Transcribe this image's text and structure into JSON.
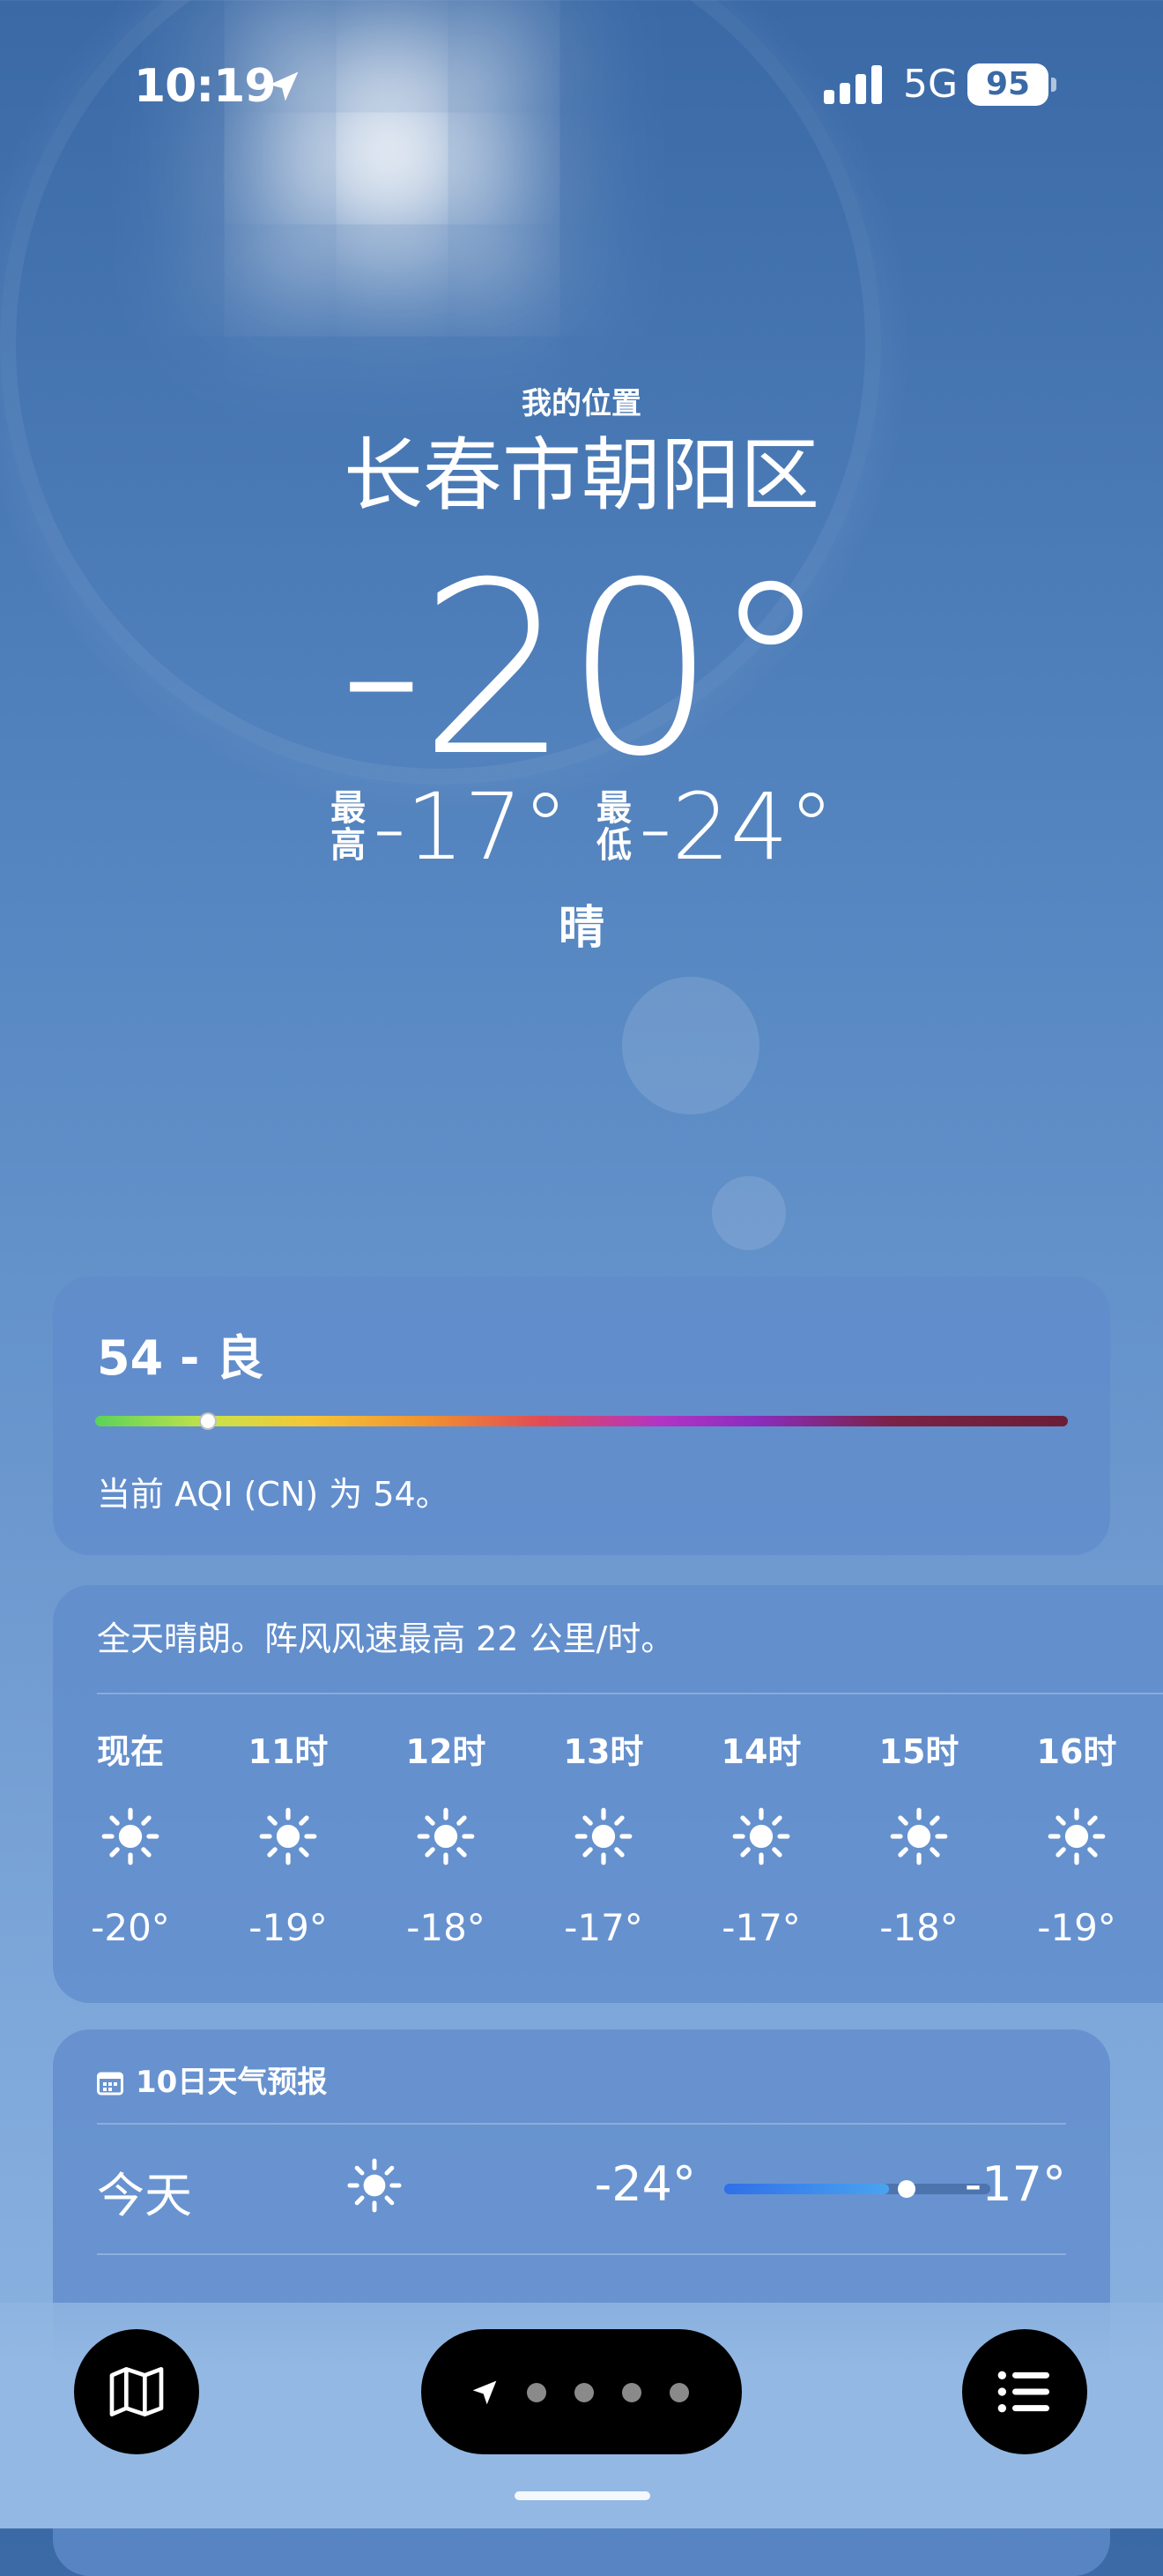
{
  "status_bar": {
    "time": "10:19",
    "network": "5G",
    "battery": "95"
  },
  "header": {
    "my_location": "我的位置",
    "city": "长春市朝阳区",
    "temperature": "-20°",
    "high_label": "最高",
    "high": "-17°",
    "low_label": "最低",
    "low": "-24°",
    "condition": "晴"
  },
  "aqi": {
    "title": "54 - 良",
    "value": 54,
    "description": "当前 AQI (CN) 为 54。"
  },
  "hourly": {
    "summary": "全天晴朗。阵风风速最高 22 公里/时。",
    "hours": [
      {
        "label": "现在",
        "icon": "sun-icon",
        "temp": "-20°"
      },
      {
        "label": "11时",
        "icon": "sun-icon",
        "temp": "-19°"
      },
      {
        "label": "12时",
        "icon": "sun-icon",
        "temp": "-18°"
      },
      {
        "label": "13时",
        "icon": "sun-icon",
        "temp": "-17°"
      },
      {
        "label": "14时",
        "icon": "sun-icon",
        "temp": "-17°"
      },
      {
        "label": "15时",
        "icon": "sun-icon",
        "temp": "-18°"
      },
      {
        "label": "16时",
        "icon": "sun-icon",
        "temp": "-19°"
      }
    ]
  },
  "ten_day": {
    "title": "10日天气预报",
    "days": [
      {
        "day": "今天",
        "icon": "sun-icon",
        "low": "-24°",
        "high": "-17°",
        "current": "-20°"
      }
    ]
  },
  "bottom_bar": {
    "map_icon": "map-icon",
    "list_icon": "list-icon",
    "pages": 5,
    "active_page": 0
  },
  "colors": {
    "sky_top": "#3a69a6",
    "card": "#608ccc",
    "temp_bar_fill": "#2f6fe8"
  }
}
